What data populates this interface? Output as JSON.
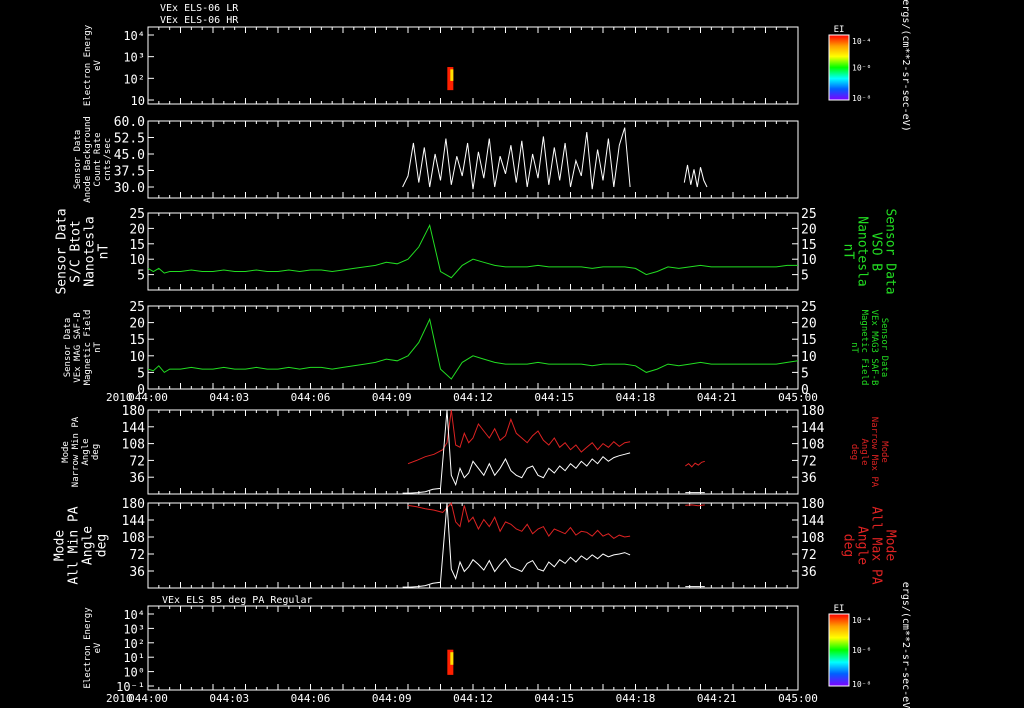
{
  "colors": {
    "background": "#000000",
    "axis": "#ffffff",
    "green": "#22dd22",
    "red": "#dd2222",
    "white": "#ffffff"
  },
  "header": {
    "line1": "VEx ELS-06 LR",
    "line2": "VEx ELS-06 HR"
  },
  "time_axis": {
    "year": "2010",
    "ticks": [
      "044:00",
      "044:03",
      "044:06",
      "044:09",
      "044:12",
      "044:15",
      "044:18",
      "044:21",
      "045:00"
    ],
    "range_min": [
      0,
      60
    ]
  },
  "chart_data": [
    {
      "id": "p1",
      "type": "heatmap",
      "ylabel": [
        "Electron Energy",
        "eV"
      ],
      "yticks": [
        "10⁴",
        "10³",
        "10²",
        "10"
      ],
      "colorbar": {
        "title": "EI",
        "labels": [
          "10⁻⁴",
          "10⁻⁶",
          "10⁻⁸"
        ]
      },
      "unit_label": "ergs/(cm**2-sr-sec-eV)",
      "data_spans_min": [
        [
          23.5,
          44.5
        ],
        [
          49.5,
          51.5
        ]
      ]
    },
    {
      "id": "p2",
      "type": "line",
      "ylabel": [
        "Sensor Data",
        "Anode Background",
        "Count Rate",
        "cnts/sec"
      ],
      "ylim": [
        25,
        60
      ],
      "yticks": [
        "60.0",
        "52.5",
        "45.0",
        "37.5",
        "30.0"
      ],
      "series": [
        {
          "color": "white",
          "segments": [
            {
              "x": [
                23.5,
                24.0,
                24.5,
                25.0,
                25.5,
                26.0,
                26.5,
                27.0,
                27.5,
                28.0,
                28.5,
                29.0,
                29.5,
                30.0,
                30.5,
                31.0,
                31.5,
                32.0,
                32.5,
                33.0,
                33.5,
                34.0,
                34.5,
                35.0,
                35.5,
                36.0,
                36.5,
                37.0,
                37.5,
                38.0,
                38.5,
                39.0,
                39.5,
                40.0,
                40.5,
                41.0,
                41.5,
                42.0,
                42.5,
                43.0,
                43.5,
                44.0,
                44.5
              ],
              "y": [
                30,
                35,
                50,
                32,
                48,
                30,
                45,
                33,
                52,
                31,
                44,
                35,
                50,
                29,
                46,
                34,
                52,
                30,
                44,
                36,
                49,
                32,
                51,
                30,
                45,
                34,
                53,
                31,
                48,
                33,
                50,
                30,
                42,
                35,
                55,
                29,
                47,
                33,
                52,
                30,
                49,
                57,
                30
              ]
            },
            {
              "x": [
                49.5,
                49.8,
                50.1,
                50.4,
                50.7,
                51.0,
                51.3,
                51.6
              ],
              "y": [
                32,
                40,
                31,
                38,
                30,
                39,
                33,
                30
              ]
            }
          ]
        }
      ]
    },
    {
      "id": "p3",
      "type": "line",
      "ylabel": [
        "Sensor Data",
        "S/C Btot",
        "Nanotesla",
        "nT"
      ],
      "right_label": [
        "Sensor Data",
        "VSO B",
        "Nanotesla",
        "nT"
      ],
      "ylim": [
        0,
        25
      ],
      "yticks": [
        25,
        20,
        15,
        10,
        5
      ],
      "series": [
        {
          "color": "green",
          "x": [
            0,
            0.5,
            1,
            1.5,
            2,
            3,
            4,
            5,
            6,
            7,
            8,
            9,
            10,
            11,
            12,
            13,
            14,
            15,
            16,
            17,
            18,
            19,
            20,
            21,
            22,
            23,
            24,
            25,
            26,
            27,
            28,
            29,
            30,
            31,
            32,
            33,
            34,
            35,
            36,
            37,
            38,
            39,
            40,
            41,
            42,
            43,
            44,
            45,
            46,
            47,
            48,
            49,
            50,
            51,
            52,
            53,
            54,
            55,
            56,
            57,
            58,
            59,
            60
          ],
          "y": [
            7,
            6,
            7,
            5.5,
            6,
            6,
            6.5,
            6,
            6,
            6.5,
            6,
            6,
            6.5,
            6,
            6,
            6.5,
            6,
            6.5,
            6.5,
            6,
            6.5,
            7,
            7.5,
            8,
            9,
            8.5,
            10,
            14,
            21,
            6,
            4,
            8,
            10,
            9,
            8,
            7.5,
            7.5,
            7.5,
            8,
            7.5,
            7.5,
            7.5,
            7.5,
            7,
            7.5,
            7.5,
            7.5,
            7,
            5,
            6,
            7.5,
            7,
            7.5,
            8,
            7.5,
            7.5,
            7.5,
            7.5,
            7.5,
            7.5,
            7.5,
            8,
            8
          ]
        }
      ]
    },
    {
      "id": "p4",
      "type": "line",
      "ylabel": [
        "Sensor Data",
        "VEx MAG SAF-B",
        "Magnetic Field",
        "nT"
      ],
      "right_label": [
        "Sensor Data",
        "VEx MAG3 SAF-B",
        "Magnetic Field",
        "nT"
      ],
      "ylim": [
        0,
        25
      ],
      "yticks": [
        25,
        20,
        15,
        10,
        5,
        0
      ],
      "series": [
        {
          "color": "green",
          "x": [
            0,
            0.5,
            1,
            1.5,
            2,
            3,
            4,
            5,
            6,
            7,
            8,
            9,
            10,
            11,
            12,
            13,
            14,
            15,
            16,
            17,
            18,
            19,
            20,
            21,
            22,
            23,
            24,
            25,
            26,
            27,
            28,
            29,
            30,
            31,
            32,
            33,
            34,
            35,
            36,
            37,
            38,
            39,
            40,
            41,
            42,
            43,
            44,
            45,
            46,
            47,
            48,
            49,
            50,
            51,
            52,
            53,
            54,
            55,
            56,
            57,
            58,
            59,
            60
          ],
          "y": [
            6,
            5.5,
            7,
            5,
            6,
            6,
            6.5,
            6,
            6,
            6.5,
            6,
            6,
            6.5,
            6,
            6,
            6.5,
            6,
            6.5,
            6.5,
            6,
            6.5,
            7,
            7.5,
            8,
            9,
            8.5,
            10,
            14,
            21,
            6,
            3,
            8,
            10,
            9,
            8,
            7.5,
            7.5,
            7.5,
            8,
            7.5,
            7.5,
            7.5,
            7.5,
            7,
            7.5,
            7.5,
            7.5,
            7,
            5,
            6,
            7.5,
            7,
            7.5,
            8,
            7.5,
            7.5,
            7.5,
            7.5,
            7.5,
            7.5,
            7.5,
            8,
            8.5
          ]
        }
      ]
    },
    {
      "id": "p5",
      "type": "line",
      "ylabel": [
        "Mode",
        "Narrow Min PA",
        "Angle",
        "deg"
      ],
      "right_label": [
        "Mode",
        "Narrow Max PA",
        "Angle",
        "deg"
      ],
      "ylim": [
        0,
        180
      ],
      "yticks": [
        180,
        144,
        108,
        72,
        36
      ],
      "series": [
        {
          "color": "red",
          "x": [
            24.0,
            24.8,
            25.6,
            26.4,
            27.2,
            27.6,
            28.0,
            28.4,
            28.8,
            29.2,
            29.6,
            30.0,
            30.5,
            31.0,
            31.5,
            32.0,
            32.5,
            33.0,
            33.5,
            34.0,
            34.5,
            35.0,
            35.5,
            36.0,
            36.5,
            37.0,
            37.5,
            38.0,
            38.5,
            39.0,
            39.5,
            40.0,
            40.5,
            41.0,
            41.5,
            42.0,
            42.5,
            43.0,
            43.5,
            44.0,
            44.5
          ],
          "y": [
            65,
            72,
            80,
            85,
            95,
            110,
            180,
            105,
            100,
            130,
            110,
            120,
            150,
            135,
            120,
            140,
            115,
            125,
            160,
            130,
            120,
            110,
            125,
            135,
            115,
            105,
            120,
            100,
            110,
            95,
            105,
            90,
            100,
            110,
            95,
            108,
            100,
            112,
            102,
            110,
            112
          ]
        },
        {
          "color": "red",
          "x": [
            49.6,
            49.9,
            50.2,
            50.5,
            50.8,
            51.1,
            51.4
          ],
          "y": [
            60,
            65,
            58,
            66,
            62,
            68,
            70
          ]
        },
        {
          "color": "white",
          "x": [
            23.5,
            24.2,
            24.9,
            25.6,
            26.3,
            27.0,
            27.6,
            28.0,
            28.4,
            28.8,
            29.2,
            29.6,
            30.0,
            30.5,
            31.0,
            31.5,
            32.0,
            32.5,
            33.0,
            33.5,
            34.0,
            34.5,
            35.0,
            35.5,
            36.0,
            36.5,
            37.0,
            37.5,
            38.0,
            38.5,
            39.0,
            39.5,
            40.0,
            40.5,
            41.0,
            41.5,
            42.0,
            42.5,
            43.0,
            43.5,
            44.0,
            44.5
          ],
          "y": [
            2,
            2,
            3,
            5,
            10,
            12,
            180,
            40,
            20,
            55,
            35,
            45,
            70,
            55,
            40,
            65,
            40,
            55,
            75,
            50,
            40,
            35,
            55,
            60,
            40,
            35,
            55,
            45,
            60,
            50,
            65,
            55,
            70,
            60,
            75,
            65,
            80,
            70,
            78,
            82,
            85,
            88
          ]
        },
        {
          "color": "white",
          "x": [
            49.6,
            50.2,
            50.8,
            51.4
          ],
          "y": [
            3,
            3,
            3,
            3
          ]
        }
      ]
    },
    {
      "id": "p6",
      "type": "line",
      "ylabel": [
        "Mode",
        "All Min PA",
        "Angle",
        "deg"
      ],
      "right_label": [
        "Mode",
        "All Max PA",
        "Angle",
        "deg"
      ],
      "ylim": [
        0,
        180
      ],
      "yticks": [
        180,
        144,
        108,
        72,
        36
      ],
      "series": [
        {
          "color": "red",
          "x": [
            24.0,
            24.8,
            25.6,
            26.4,
            27.2,
            27.6,
            28.0,
            28.4,
            28.8,
            29.2,
            29.6,
            30.0,
            30.5,
            31.0,
            31.5,
            32.0,
            32.5,
            33.0,
            33.5,
            34.0,
            34.5,
            35.0,
            35.5,
            36.0,
            36.5,
            37.0,
            37.5,
            38.0,
            38.5,
            39.0,
            39.5,
            40.0,
            40.5,
            41.0,
            41.5,
            42.0,
            42.5,
            43.0,
            43.5,
            44.0,
            44.5
          ],
          "y": [
            175,
            172,
            168,
            165,
            160,
            170,
            180,
            140,
            130,
            175,
            140,
            150,
            125,
            145,
            130,
            150,
            120,
            140,
            135,
            125,
            120,
            135,
            115,
            125,
            130,
            110,
            125,
            120,
            115,
            128,
            112,
            120,
            118,
            110,
            122,
            110,
            115,
            105,
            112,
            108,
            110
          ]
        },
        {
          "color": "red",
          "x": [
            49.6,
            50.2,
            50.8,
            51.4
          ],
          "y": [
            175,
            176,
            174,
            176
          ]
        },
        {
          "color": "white",
          "x": [
            23.5,
            24.2,
            24.9,
            25.6,
            26.3,
            27.0,
            27.6,
            28.0,
            28.4,
            28.8,
            29.2,
            29.6,
            30.0,
            30.5,
            31.0,
            31.5,
            32.0,
            32.5,
            33.0,
            33.5,
            34.0,
            34.5,
            35.0,
            35.5,
            36.0,
            36.5,
            37.0,
            37.5,
            38.0,
            38.5,
            39.0,
            39.5,
            40.0,
            40.5,
            41.0,
            41.5,
            42.0,
            42.5,
            43.0,
            43.5,
            44.0,
            44.5
          ],
          "y": [
            2,
            2,
            3,
            5,
            10,
            12,
            180,
            40,
            20,
            55,
            35,
            45,
            60,
            50,
            38,
            58,
            35,
            50,
            62,
            45,
            40,
            35,
            52,
            58,
            40,
            36,
            55,
            45,
            60,
            52,
            65,
            55,
            68,
            60,
            70,
            62,
            72,
            66,
            70,
            72,
            75,
            70
          ]
        },
        {
          "color": "white",
          "x": [
            49.6,
            50.2,
            50.8,
            51.4
          ],
          "y": [
            3,
            3,
            3,
            3
          ]
        }
      ]
    },
    {
      "id": "p7",
      "type": "heatmap",
      "title": "VEx ELS 85 deg PA Regular",
      "ylabel": [
        "Electron Energy",
        "eV"
      ],
      "yticks": [
        "10⁴",
        "10³",
        "10²",
        "10¹",
        "10⁰",
        "10⁻¹"
      ],
      "colorbar": {
        "title": "EI",
        "labels": [
          "10⁻⁴",
          "10⁻⁶",
          "10⁻⁸"
        ]
      },
      "unit_label": "ergs/(cm**2-sr-sec-eV)",
      "data_spans_min": [
        [
          23.5,
          44.5
        ],
        [
          49.5,
          51.5
        ]
      ]
    }
  ]
}
